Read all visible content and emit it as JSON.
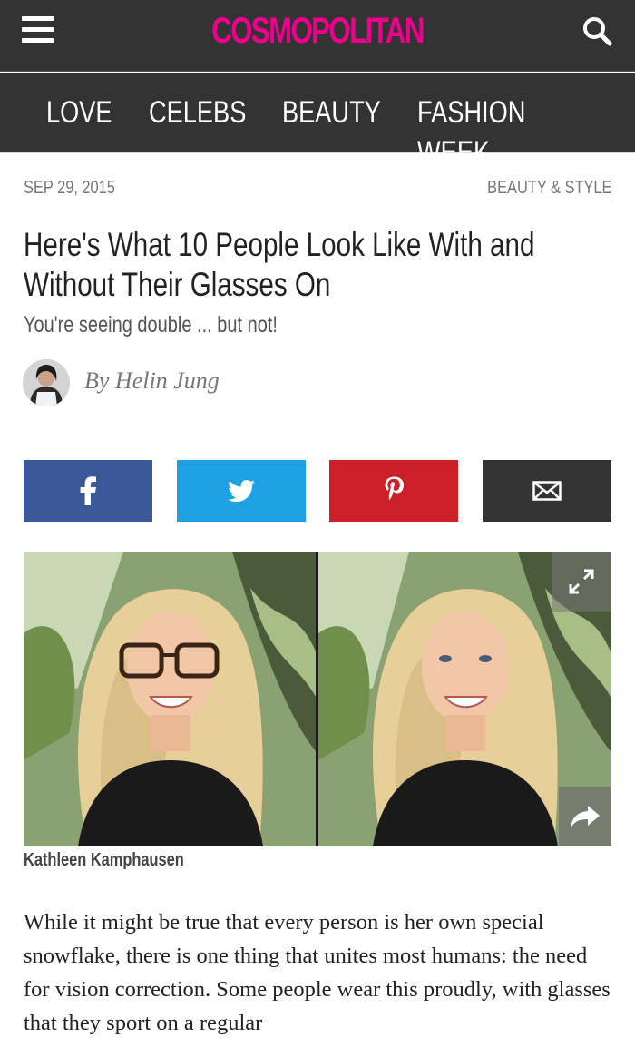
{
  "header": {
    "logo": "COSMOPOLITAN",
    "menu_icon": "hamburger-menu-icon",
    "search_icon": "search-icon",
    "logo_color": "#ec008c",
    "background": "#333333"
  },
  "nav": {
    "items": [
      {
        "label": "LOVE"
      },
      {
        "label": "CELEBS"
      },
      {
        "label": "BEAUTY"
      },
      {
        "label": "FASHION WEEK"
      }
    ]
  },
  "article": {
    "date": "SEP 29, 2015",
    "section": "BEAUTY & STYLE",
    "headline": "Here's What 10 People Look Like With and Without Their Glasses On",
    "dek": "You're seeing double ... but not!",
    "byline": "By Helin Jung",
    "image_caption": "Kathleen Kamphausen",
    "body_start": "While it might be true that every person is her own special snowflake, there is one thing that unites most humans: the need for vision correction. Some people wear this proudly, with glasses that they sport on a regular"
  },
  "share": {
    "buttons": [
      {
        "name": "facebook",
        "icon": "facebook-icon",
        "color": "#3b5998"
      },
      {
        "name": "twitter",
        "icon": "twitter-icon",
        "color": "#1da1e2"
      },
      {
        "name": "pinterest",
        "icon": "pinterest-icon",
        "color": "#cb2027"
      },
      {
        "name": "email",
        "icon": "email-icon",
        "color": "#333333"
      }
    ]
  }
}
